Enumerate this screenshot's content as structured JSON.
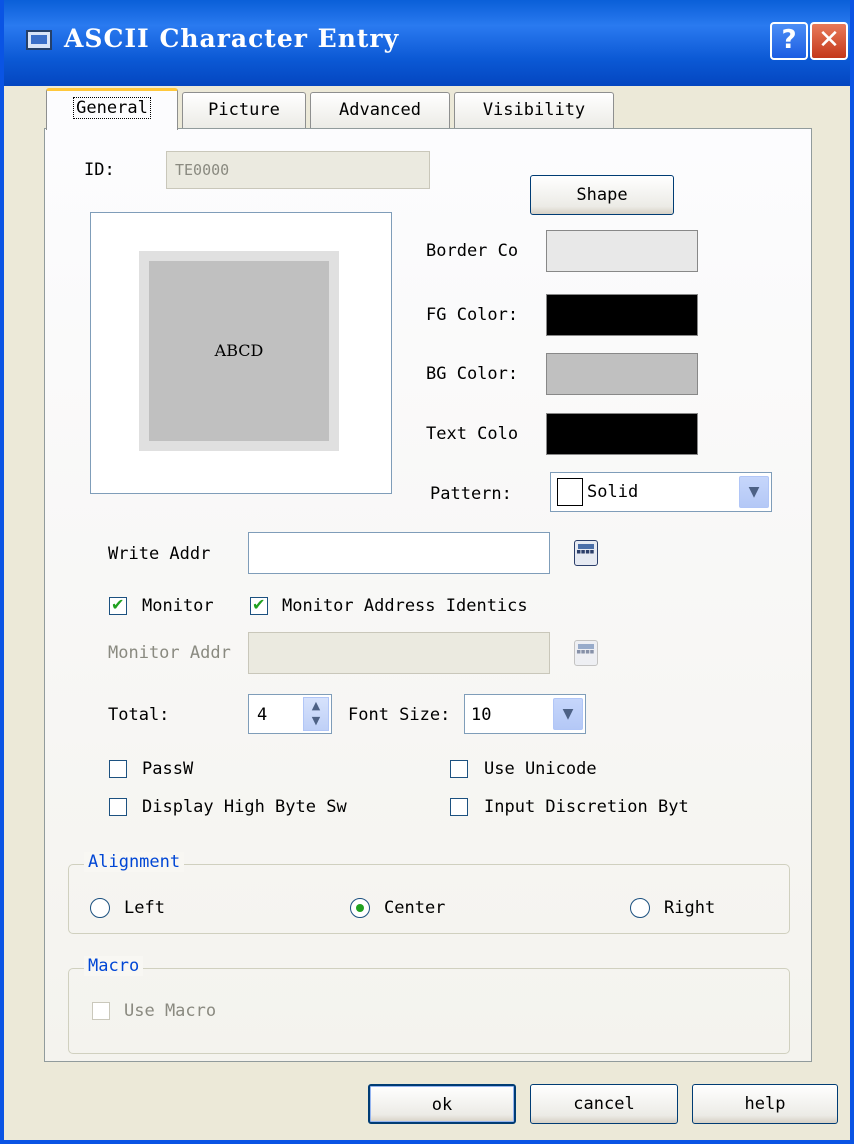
{
  "window": {
    "title": "ASCII Character Entry",
    "help_glyph": "?",
    "close_glyph": "✕"
  },
  "tabs": [
    "General",
    "Picture",
    "Advanced",
    "Visibility"
  ],
  "general": {
    "id_label": "ID:",
    "id_value": "TE0000",
    "shape_button": "Shape",
    "preview_text": "ABCD",
    "border_color_label": "Border Co",
    "fg_color_label": "FG Color:",
    "bg_color_label": "BG Color:",
    "text_color_label": "Text Colo",
    "pattern_label": "Pattern:",
    "pattern_value": "Solid",
    "colors": {
      "border": "#e8e8e8",
      "fg": "#000000",
      "bg": "#c0c0c0",
      "text": "#000000",
      "preview_outer": "#e0e0e0",
      "preview_inner": "#c0c0c0"
    },
    "write_addr_label": "Write Addr",
    "write_addr_value": "",
    "monitor_label": "Monitor",
    "monitor_checked": true,
    "monitor_identical_label": "Monitor Address Identics",
    "monitor_identical_checked": true,
    "monitor_addr_label": "Monitor Addr",
    "total_label": "Total:",
    "total_value": "4",
    "font_size_label": "Font Size:",
    "font_size_value": "10",
    "password_label": "PassW",
    "use_unicode_label": "Use Unicode",
    "high_byte_label": "Display High Byte Sw",
    "input_discretion_label": "Input Discretion Byt",
    "alignment": {
      "title": "Alignment",
      "left": "Left",
      "center": "Center",
      "right": "Right",
      "selected": "Center"
    },
    "macro": {
      "title": "Macro",
      "use_macro_label": "Use Macro"
    }
  },
  "footer": {
    "ok": "ok",
    "cancel": "cancel",
    "help": "help"
  },
  "icons": {
    "calculator": "calculator-icon",
    "dropdown": "chevron-down-icon",
    "spinner": "spin-updown-icon"
  }
}
